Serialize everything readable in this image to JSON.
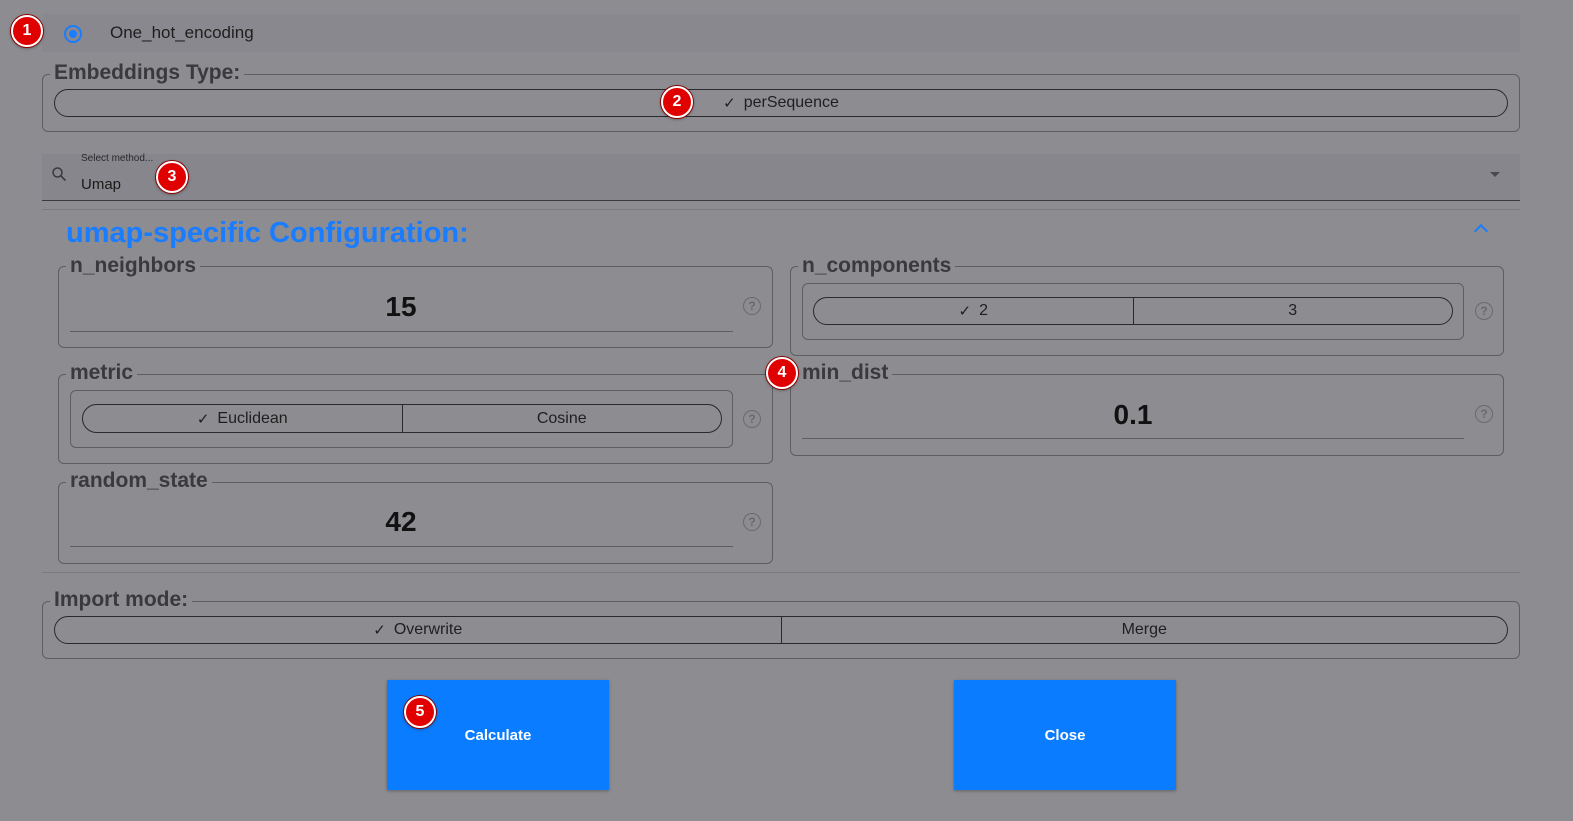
{
  "embedder": {
    "label": "One_hot_encoding",
    "selected": true
  },
  "embeddings_type": {
    "legend": "Embeddings Type:",
    "options": [
      {
        "label": "perSequence",
        "selected": true
      }
    ]
  },
  "method_select": {
    "placeholder": "Select method...",
    "value": "Umap"
  },
  "config": {
    "title": "umap-specific Configuration:",
    "n_neighbors": {
      "label": "n_neighbors",
      "value": "15"
    },
    "n_components": {
      "label": "n_components",
      "options": [
        {
          "label": "2",
          "selected": true
        },
        {
          "label": "3",
          "selected": false
        }
      ]
    },
    "metric": {
      "label": "metric",
      "options": [
        {
          "label": "Euclidean",
          "selected": true
        },
        {
          "label": "Cosine",
          "selected": false
        }
      ]
    },
    "min_dist": {
      "label": "min_dist",
      "value": "0.1"
    },
    "random_state": {
      "label": "random_state",
      "value": "42"
    },
    "help_glyph": "?"
  },
  "import_mode": {
    "legend": "Import mode:",
    "options": [
      {
        "label": "Overwrite",
        "selected": true
      },
      {
        "label": "Merge",
        "selected": false
      }
    ]
  },
  "buttons": {
    "calculate": "Calculate",
    "close": "Close"
  },
  "markers": [
    "1",
    "2",
    "3",
    "4",
    "5"
  ],
  "check_glyph": "✓",
  "colors": {
    "accent": "#1a7cff",
    "button": "#0a7cff",
    "marker": "#e00000",
    "background": "#8c8c91"
  }
}
